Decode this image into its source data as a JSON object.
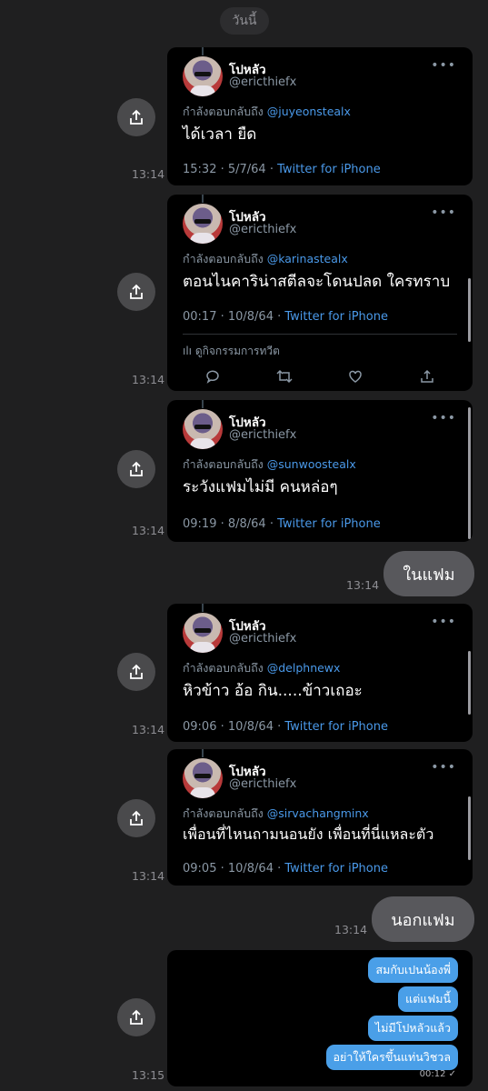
{
  "date_label": "วันนี้",
  "tweets": [
    {
      "name": "โปหลัว",
      "handle": "@ericthiefx",
      "reply_prefix": "กำลังตอบกลับถึง",
      "mention": "@juyeonstealx",
      "text": "ได้เวลา ยืด",
      "date": "15:32 · 5/7/64 ·",
      "source": "Twitter for iPhone",
      "sent_time": "13:14"
    },
    {
      "name": "โปหลัว",
      "handle": "@ericthiefx",
      "reply_prefix": "กำลังตอบกลับถึง",
      "mention": "@karinastealx",
      "text": "ตอนไนคาริน่าสตีลจะโดนปลด ใครทราบ",
      "date": "00:17 · 10/8/64 ·",
      "source": "Twitter for iPhone",
      "activity": "ดูกิจกรรมการทวีต",
      "sent_time": "13:14"
    },
    {
      "name": "โปหลัว",
      "handle": "@ericthiefx",
      "reply_prefix": "กำลังตอบกลับถึง",
      "mention": "@sunwoostealx",
      "text": "ระวังแฟมไม่มี คนหล่อๆ",
      "date": "09:19 · 8/8/64 ·",
      "source": "Twitter for iPhone",
      "sent_time": "13:14"
    },
    {
      "name": "โปหลัว",
      "handle": "@ericthiefx",
      "reply_prefix": "กำลังตอบกลับถึง",
      "mention": "@delphnewx",
      "text": "หิวข้าว อ้อ กิน.....ข้าวเถอะ",
      "date": "09:06 · 10/8/64 ·",
      "source": "Twitter for iPhone",
      "sent_time": "13:14"
    },
    {
      "name": "โปหลัว",
      "handle": "@ericthiefx",
      "reply_prefix": "กำลังตอบกลับถึง",
      "mention": "@sirvachangminx",
      "text": "เพื่อนที่ไหนถามนอนยัง เพื่อนที่นี่แหละตัว",
      "date": "09:05 · 10/8/64 ·",
      "source": "Twitter for iPhone",
      "sent_time": "13:14"
    }
  ],
  "bubbles": [
    {
      "text": "ในแฟม",
      "time": "13:14"
    },
    {
      "text": "นอกแฟม",
      "time": "13:14"
    }
  ],
  "video": {
    "messages": [
      "สมกับเปนน้องพี่",
      "แต่แฟมนี้",
      "ไม่มีโปหลัวแล้ว",
      "อย่าให้ใครขึ้นแท่นวิชวล"
    ],
    "duration": "00:12 ✓",
    "sent_time": "13:15"
  },
  "colors": {
    "background": "#1f1f20",
    "card": "#000000",
    "link": "#4a99e9",
    "bubble": "#58585c",
    "dm": "#4a9fe8"
  },
  "icons": {
    "share": "share-icon",
    "more": "more-dots-icon",
    "reply": "reply-icon",
    "retweet": "retweet-icon",
    "like": "like-icon"
  }
}
